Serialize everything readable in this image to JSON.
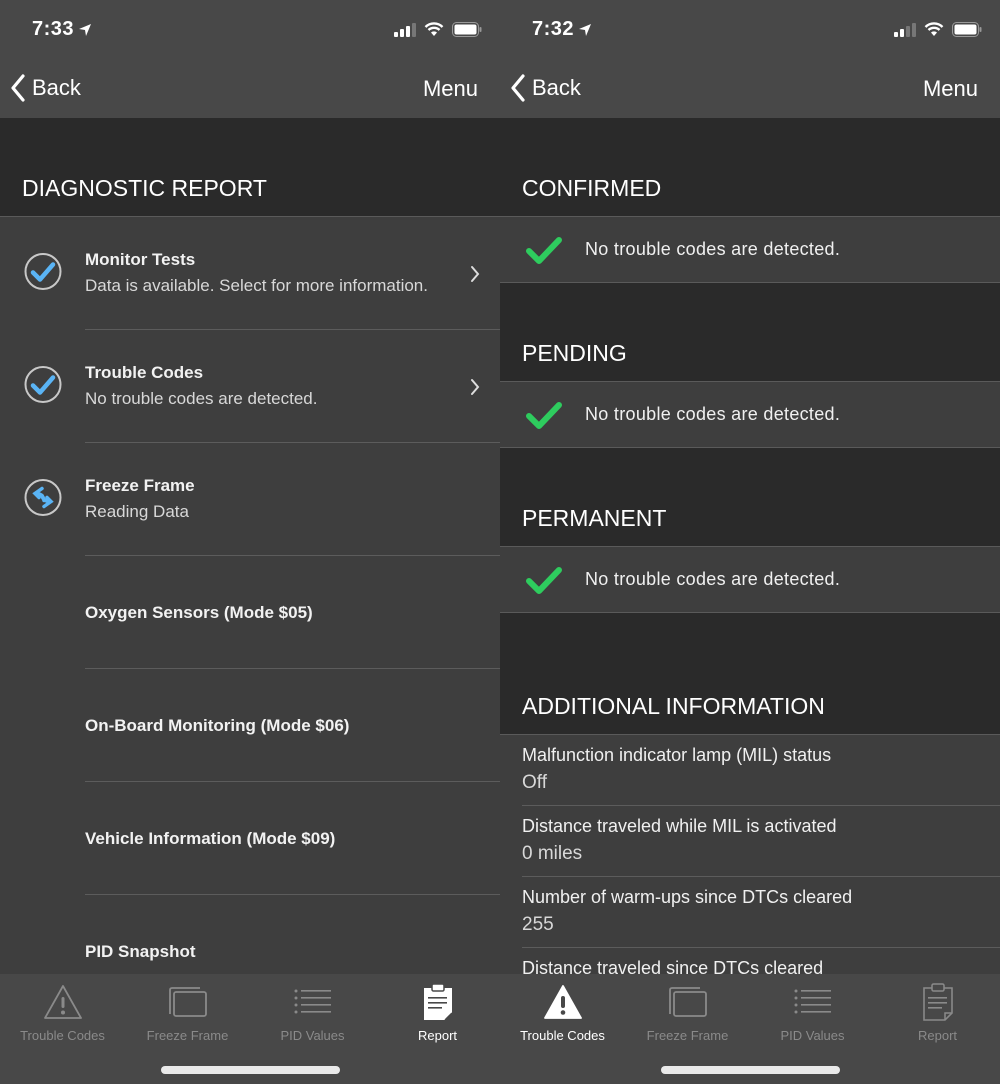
{
  "left": {
    "status": {
      "time": "7:33"
    },
    "nav": {
      "back_label": "Back",
      "menu_label": "Menu"
    },
    "header": "DIAGNOSTIC REPORT",
    "items": [
      {
        "title": "Monitor Tests",
        "sub": "Data is available. Select for more information.",
        "icon": "check-circle-icon",
        "chevron": true
      },
      {
        "title": "Trouble Codes",
        "sub": "No trouble codes are detected.",
        "icon": "check-circle-icon",
        "chevron": true
      },
      {
        "title": "Freeze Frame",
        "sub": "Reading Data",
        "icon": "sync-circle-icon",
        "chevron": false
      },
      {
        "title": "Oxygen Sensors (Mode $05)"
      },
      {
        "title": "On-Board Monitoring (Mode $06)"
      },
      {
        "title": "Vehicle Information (Mode $09)"
      },
      {
        "title": "PID Snapshot"
      }
    ],
    "tabs": [
      {
        "label": "Trouble Codes",
        "icon": "warning-triangle-icon",
        "active": false
      },
      {
        "label": "Freeze Frame",
        "icon": "frames-icon",
        "active": false
      },
      {
        "label": "PID Values",
        "icon": "list-icon",
        "active": false
      },
      {
        "label": "Report",
        "icon": "clipboard-icon",
        "active": true
      }
    ]
  },
  "right": {
    "status": {
      "time": "7:32"
    },
    "nav": {
      "back_label": "Back",
      "menu_label": "Menu"
    },
    "sections": [
      {
        "header": "CONFIRMED",
        "message": "No trouble codes are detected."
      },
      {
        "header": "PENDING",
        "message": "No trouble codes are detected."
      },
      {
        "header": "PERMANENT",
        "message": "No trouble codes are detected."
      }
    ],
    "additional": {
      "header": "ADDITIONAL INFORMATION",
      "rows": [
        {
          "label": "Malfunction indicator lamp (MIL) status",
          "value": "Off"
        },
        {
          "label": "Distance traveled while MIL is activated",
          "value": "0 miles"
        },
        {
          "label": "Number of warm-ups since DTCs cleared",
          "value": "255"
        },
        {
          "label": "Distance traveled since DTCs cleared",
          "value": ""
        }
      ]
    },
    "tabs": [
      {
        "label": "Trouble Codes",
        "icon": "warning-triangle-icon",
        "active": true
      },
      {
        "label": "Freeze Frame",
        "icon": "frames-icon",
        "active": false
      },
      {
        "label": "PID Values",
        "icon": "list-icon",
        "active": false
      },
      {
        "label": "Report",
        "icon": "clipboard-icon",
        "active": false
      }
    ]
  },
  "colors": {
    "accent_blue": "#5ab4f5",
    "check_green": "#2ecc5e",
    "header_bg": "#2a2a2a",
    "row_bg": "#3e3e3e",
    "bar_bg": "#484848"
  }
}
